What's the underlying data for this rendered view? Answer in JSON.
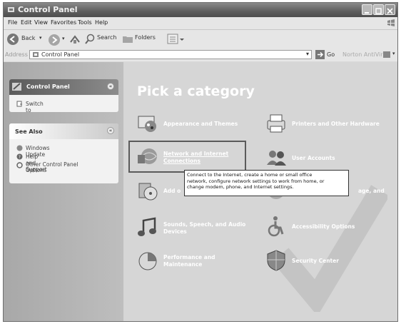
{
  "window": {
    "title": "Control Panel"
  },
  "menu": [
    "File",
    "Edit",
    "View",
    "Favorites",
    "Tools",
    "Help"
  ],
  "toolbar": {
    "back": "Back",
    "search": "Search",
    "folders": "Folders"
  },
  "address": {
    "label": "Address",
    "value": "Control Panel",
    "go": "Go",
    "extra": "Norton AntiVirus"
  },
  "sidebar": {
    "panel_title": "Control Panel",
    "switch_view": "Switch to Classic View",
    "see_also_title": "See Also",
    "see_also": [
      "Windows Update",
      "Help and Support",
      "Other Control Panel Options"
    ]
  },
  "main": {
    "heading": "Pick a category",
    "categories": {
      "appearance": "Appearance and Themes",
      "printers": "Printers and Other Hardware",
      "network_1": "Network and Internet",
      "network_2": "Connections",
      "users": "User Accounts",
      "addremove": "Add o",
      "regional": "age, and",
      "sounds_1": "Sounds, Speech, and Audio",
      "sounds_2": "Devices",
      "accessibility": "Accessibility Options",
      "performance_1": "Performance and",
      "performance_2": "Maintenance",
      "security": "Security Center"
    },
    "tooltip": [
      "Connect to the Internet, create a home or small office",
      "network, configure network settings to work from home, or",
      "change modem, phone, and Internet settings."
    ]
  }
}
